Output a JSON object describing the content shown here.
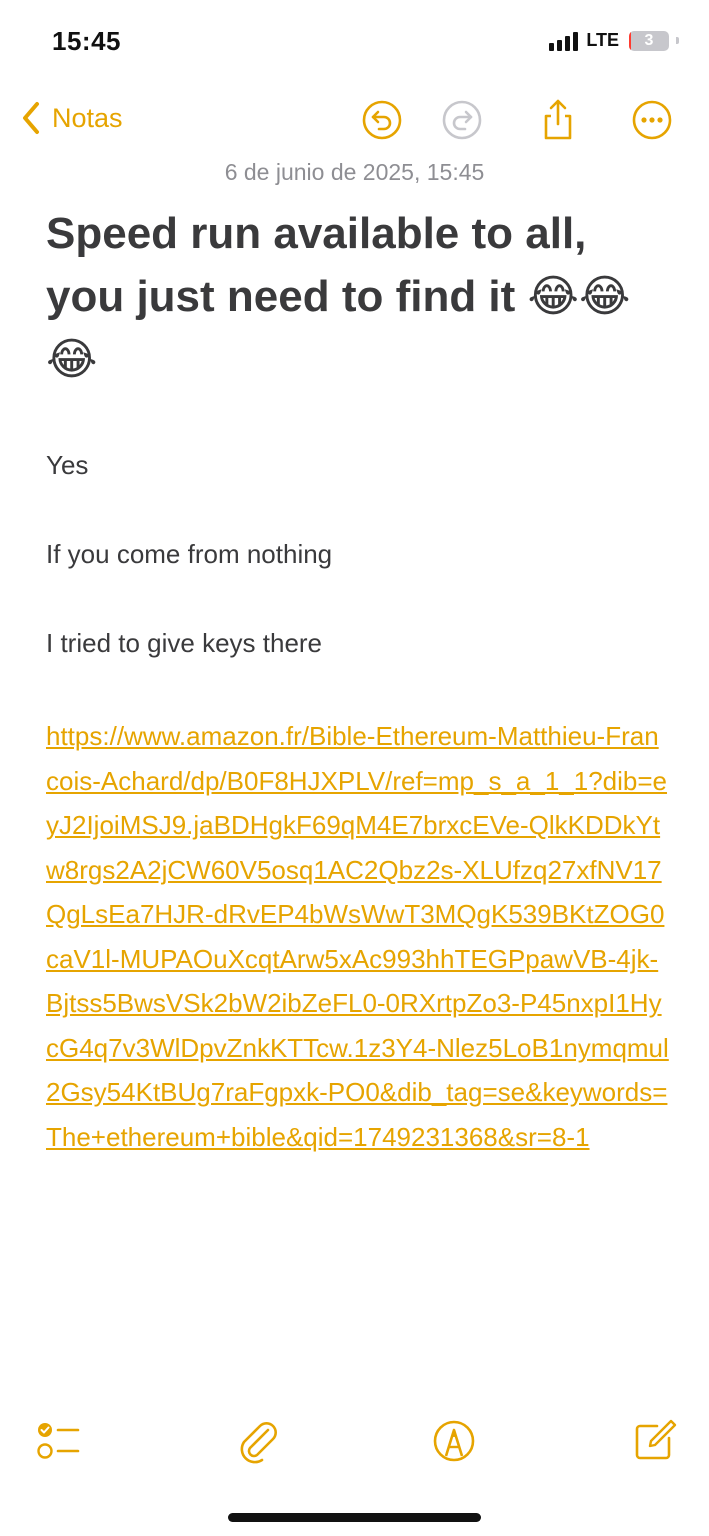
{
  "status_bar": {
    "time": "15:45",
    "network": "LTE",
    "battery_level": "3",
    "battery_fraction": 0.03
  },
  "nav": {
    "back_label": "Notas",
    "icons": [
      "chevron-left-icon",
      "undo-icon",
      "redo-icon",
      "share-icon",
      "more-icon"
    ]
  },
  "note": {
    "date": "6 de junio de 2025, 15:45",
    "title": "Speed run available to all, you just need to find it 😂😂😂",
    "lines": [
      "Yes",
      "If you come from nothing",
      "I tried to give keys there"
    ],
    "link": "https://www.amazon.fr/Bible-Ethereum-Matthieu-Francois-Achard/dp/B0F8HJXPLV/ref=mp_s_a_1_1?dib=eyJ2IjoiMSJ9.jaBDHgkF69qM4E7brxcEVe-QlkKDDkYtw8rgs2A2jCW60V5osq1AC2Qbz2s-XLUfzq27xfNV17QgLsEa7HJR-dRvEP4bWsWwT3MQgK539BKtZOG0caV1l-MUPAOuXcqtArw5xAc993hhTEGPpawVB-4jk-Bjtss5BwsVSk2bW2ibZeFL0-0RXrtpZo3-P45nxpI1HycG4q7v3WlDpvZnkKTTcw.1z3Y4-Nlez5LoB1nymqmul2Gsy54KtBUg7raFgpxk-PO0&dib_tag=se&keywords=The+ethereum+bible&qid=1749231368&sr=8-1"
  },
  "toolbar": {
    "icons": [
      "checklist-icon",
      "paperclip-icon",
      "markup-pen-icon",
      "compose-icon"
    ]
  },
  "colors": {
    "accent": "#e6a400",
    "text": "#3a3a3c",
    "secondary": "#8e8e93",
    "battery_low": "#ff3b30"
  }
}
